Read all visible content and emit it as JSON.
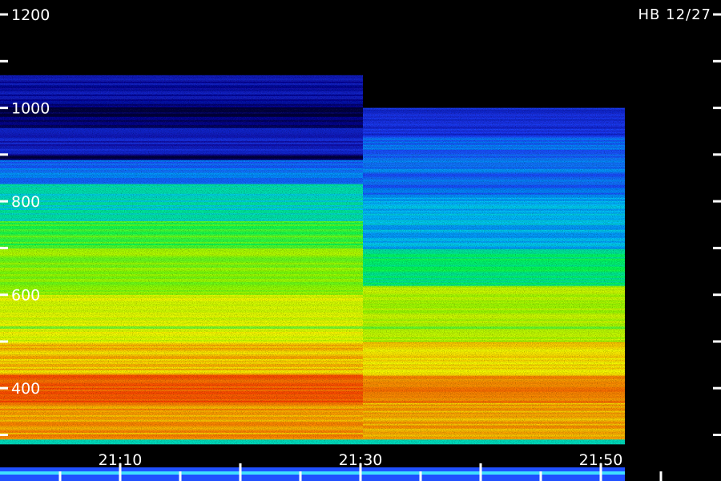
{
  "chart_data": {
    "type": "heatmap",
    "title": "",
    "label": "HB 12/27",
    "xlabel": "",
    "ylabel": "",
    "x_ticks": [
      {
        "label": "21:10",
        "t": 10
      },
      {
        "label": "21:30",
        "t": 30
      },
      {
        "label": "21:50",
        "t": 50
      }
    ],
    "y_ticks": [
      {
        "label": "1200",
        "v": 1200
      },
      {
        "label": "1000",
        "v": 1000
      },
      {
        "label": "800",
        "v": 800
      },
      {
        "label": "600",
        "v": 600
      },
      {
        "label": "400",
        "v": 400
      }
    ],
    "x_range_minutes": [
      0,
      60
    ],
    "y_range": [
      270,
      1200
    ],
    "data_end_minutes": 52,
    "colormap": [
      "#000000",
      "#1010a0",
      "#2040ff",
      "#00c8ff",
      "#00ff60",
      "#a0ff00",
      "#ffff00",
      "#ff8000",
      "#ff2000"
    ],
    "segments": [
      {
        "t_start": 0,
        "t_end": 30.2,
        "bands": [
          {
            "f_low": 1010,
            "f_high": 1070,
            "intensity": 0.15
          },
          {
            "f_low": 900,
            "f_high": 960,
            "intensity": 0.18
          },
          {
            "f_low": 840,
            "f_high": 890,
            "intensity": 0.3
          },
          {
            "f_low": 760,
            "f_high": 840,
            "intensity": 0.42
          },
          {
            "f_low": 700,
            "f_high": 760,
            "intensity": 0.55
          },
          {
            "f_low": 600,
            "f_high": 700,
            "intensity": 0.62
          },
          {
            "f_low": 500,
            "f_high": 600,
            "intensity": 0.72
          },
          {
            "f_low": 430,
            "f_high": 500,
            "intensity": 0.8
          },
          {
            "f_low": 370,
            "f_high": 430,
            "intensity": 0.92
          },
          {
            "f_low": 290,
            "f_high": 370,
            "intensity": 0.84
          }
        ]
      },
      {
        "t_start": 30.2,
        "t_end": 52,
        "bands": [
          {
            "f_low": 940,
            "f_high": 1000,
            "intensity": 0.22
          },
          {
            "f_low": 810,
            "f_high": 940,
            "intensity": 0.3
          },
          {
            "f_low": 700,
            "f_high": 810,
            "intensity": 0.36
          },
          {
            "f_low": 620,
            "f_high": 700,
            "intensity": 0.48
          },
          {
            "f_low": 500,
            "f_high": 620,
            "intensity": 0.66
          },
          {
            "f_low": 430,
            "f_high": 500,
            "intensity": 0.78
          },
          {
            "f_low": 370,
            "f_high": 430,
            "intensity": 0.88
          },
          {
            "f_low": 290,
            "f_high": 370,
            "intensity": 0.82
          }
        ]
      }
    ],
    "grid": false
  }
}
